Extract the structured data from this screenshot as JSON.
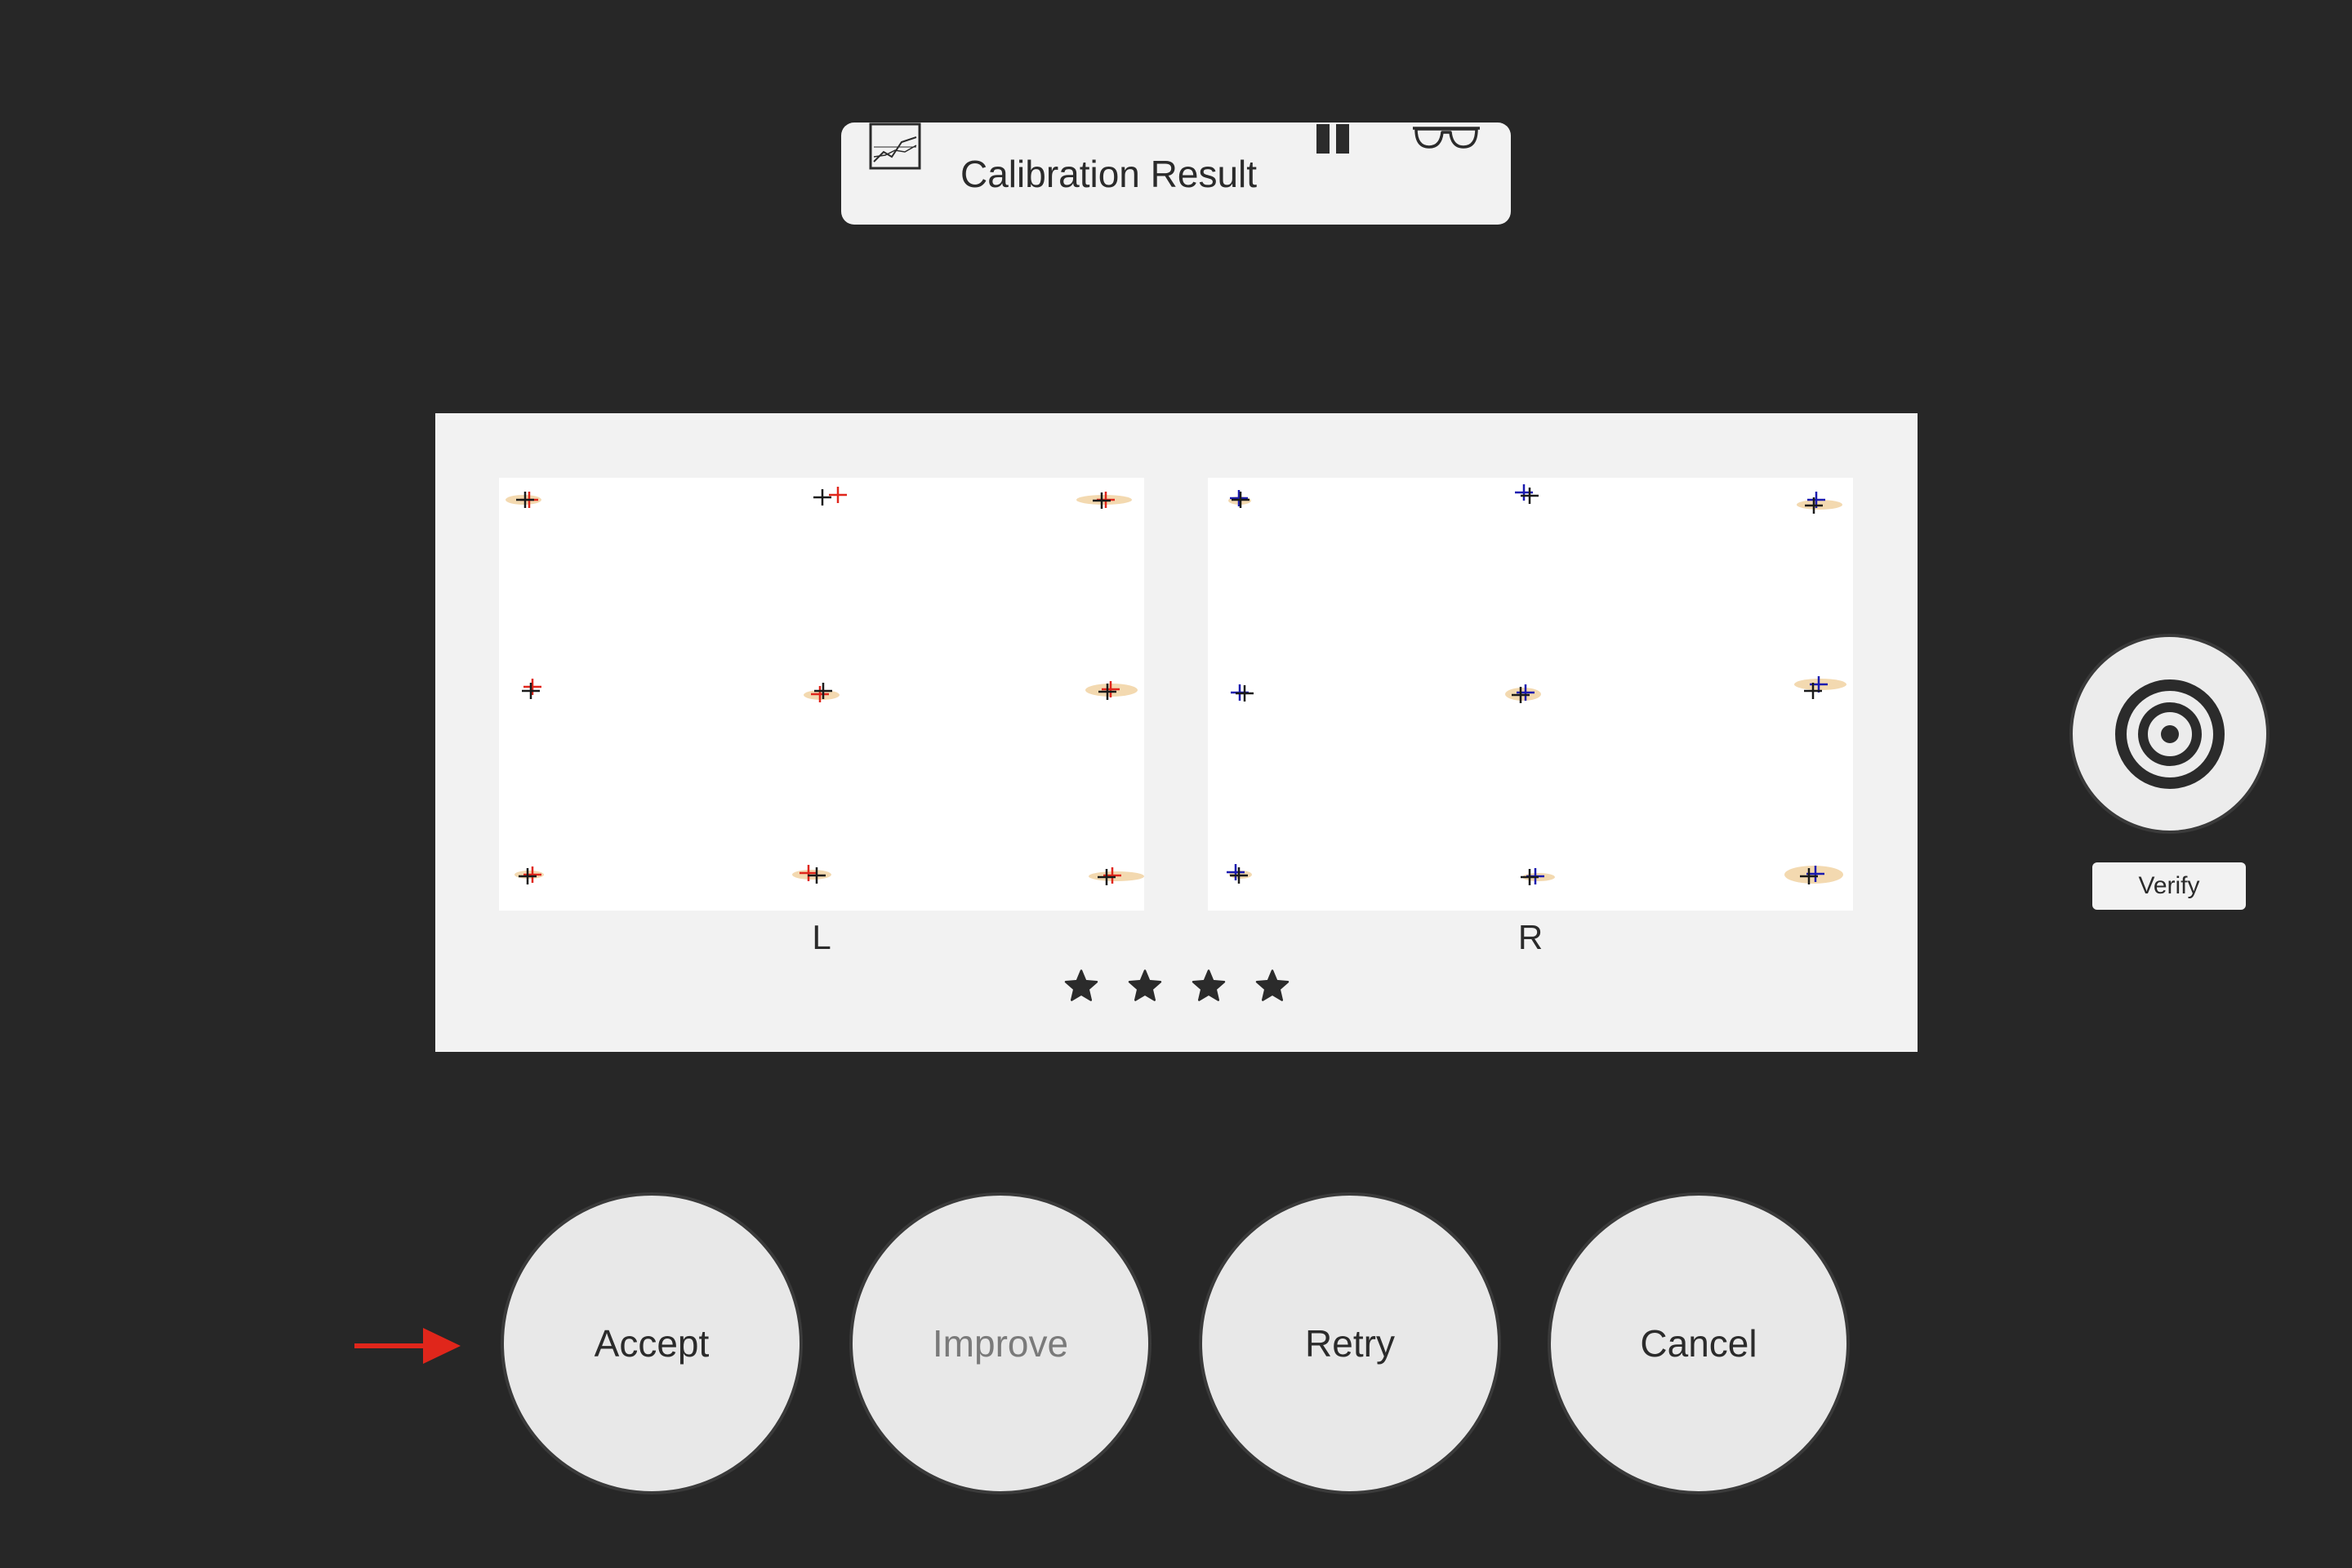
{
  "header": {
    "title": "Calibration Result",
    "icons": [
      "chart-icon",
      "pause-icon",
      "glasses-icon"
    ]
  },
  "panel": {
    "left_label": "L",
    "right_label": "R",
    "rating": {
      "stars": 4,
      "max": 4
    }
  },
  "verify": {
    "label": "Verify",
    "icon": "target-icon"
  },
  "actions": {
    "accept": "Accept",
    "improve": "Improve",
    "retry": "Retry",
    "cancel": "Cancel"
  },
  "colors": {
    "background": "#272727",
    "panel": "#f2f2f2",
    "left_eye_samples": "#e0261b",
    "right_eye_samples": "#1a1ab0",
    "ellipse": "#f3d9b0",
    "indicator_arrow": "#e0261b"
  }
}
